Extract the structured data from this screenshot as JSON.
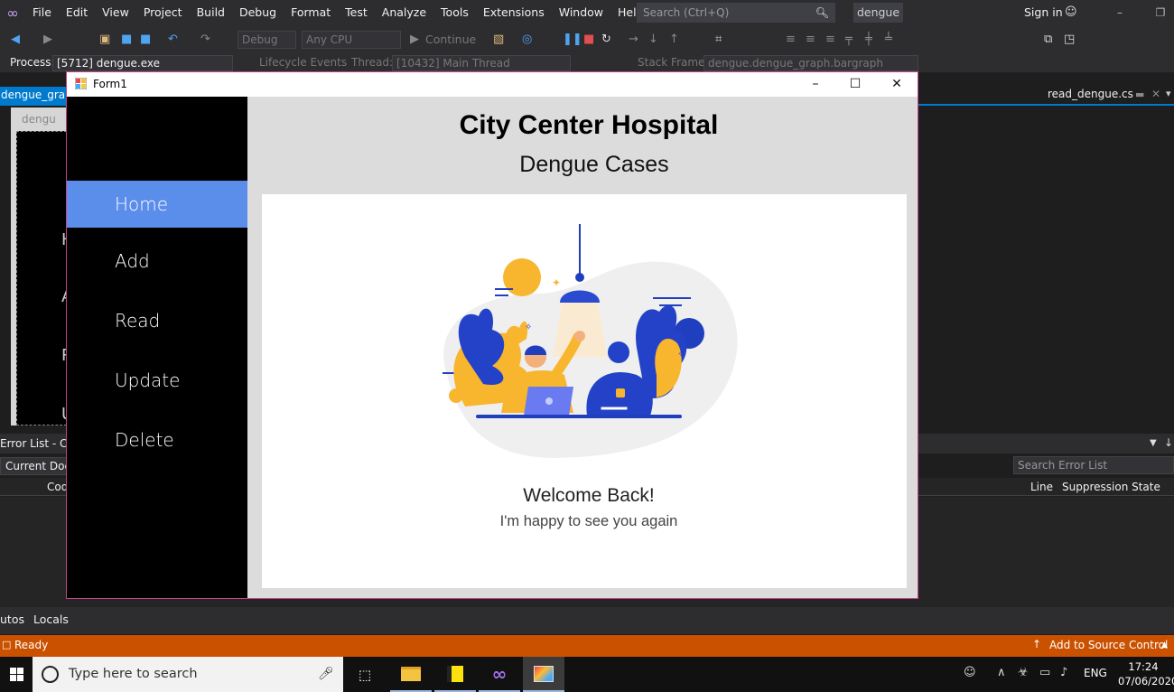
{
  "vs": {
    "menu": [
      "File",
      "Edit",
      "View",
      "Project",
      "Build",
      "Debug",
      "Format",
      "Test",
      "Analyze",
      "Tools",
      "Extensions",
      "Window",
      "Help"
    ],
    "search_placeholder": "Search (Ctrl+Q)",
    "solution_name": "dengue",
    "sign_in": "Sign in",
    "toolbar": {
      "config": "Debug",
      "platform": "Any CPU",
      "continue": "Continue"
    },
    "debug": {
      "process_label": "Process:",
      "process_value": "[5712] dengue.exe",
      "lifecycle": "Lifecycle Events",
      "thread_label": "Thread:",
      "thread_value": "[10432] Main Thread",
      "stack_label": "Stack Frame:",
      "stack_value": "dengue.dengue_graph.bargraph"
    },
    "tabs": {
      "left": "dengue_graph",
      "designer_tab": "dengu",
      "right": "read_dengue.cs"
    },
    "designer_letters": [
      "H",
      "A",
      "R",
      "U"
    ],
    "error_list": {
      "title": "Error List - Cur",
      "scope": "Current Docu",
      "search_placeholder": "Search Error List",
      "col_code": "Cod",
      "col_line": "Line",
      "col_suppression": "Suppression State"
    },
    "bottom_tabs": [
      "utos",
      "Locals"
    ],
    "status": "Ready",
    "source_control": "Add to Source Control"
  },
  "taskbar": {
    "search_placeholder": "Type here to search",
    "lang": "ENG",
    "time": "17:24",
    "date": "07/06/2020"
  },
  "form": {
    "title": "Form1",
    "nav": [
      "Home",
      "Add",
      "Read",
      "Update",
      "Delete"
    ],
    "active_nav": "Home",
    "hospital_name": "City Center Hospital",
    "subtitle": "Dengue Cases",
    "welcome": "Welcome Back!",
    "message": "I'm happy to see you again",
    "colors": {
      "nav_active": "#5b8deb",
      "sidebar": "#000000",
      "accent_blue": "#1f3fbf",
      "accent_yellow": "#f8b52e"
    }
  }
}
